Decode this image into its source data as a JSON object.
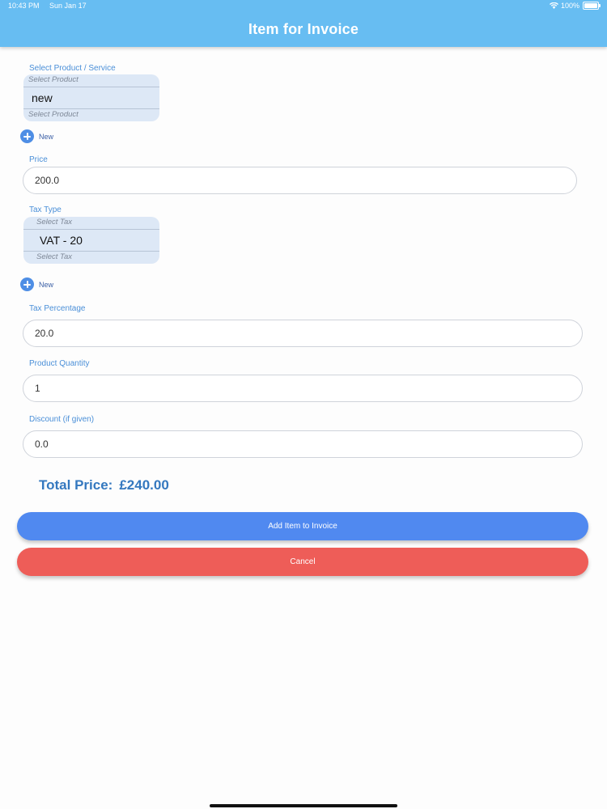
{
  "status_bar": {
    "time": "10:43 PM",
    "date": "Sun Jan 17",
    "battery_text": "100%"
  },
  "header": {
    "title": "Item for Invoice",
    "color": "#67bdf2"
  },
  "form": {
    "product": {
      "label": "Select Product / Service",
      "ghost_above": "Select Product",
      "selected": "new",
      "ghost_below": "Select Product",
      "new_label": "New"
    },
    "price": {
      "label": "Price",
      "value": "200.0"
    },
    "tax_type": {
      "label": "Tax Type",
      "ghost_above": "Select Tax",
      "selected": "VAT - 20",
      "ghost_below": "Select Tax",
      "new_label": "New"
    },
    "tax_percentage": {
      "label": "Tax Percentage",
      "value": "20.0"
    },
    "quantity": {
      "label": "Product Quantity",
      "value": "1"
    },
    "discount": {
      "label": "Discount (if given)",
      "value": "0.0"
    }
  },
  "total": {
    "label": "Total Price:",
    "amount": "£240.00"
  },
  "buttons": {
    "add_label": "Add Item to Invoice",
    "add_color": "#5089f0",
    "cancel_label": "Cancel",
    "cancel_color": "#ee5d58"
  },
  "icons": {
    "add_new": "plus-circle-icon",
    "wifi": "wifi-icon",
    "battery": "battery-icon"
  }
}
